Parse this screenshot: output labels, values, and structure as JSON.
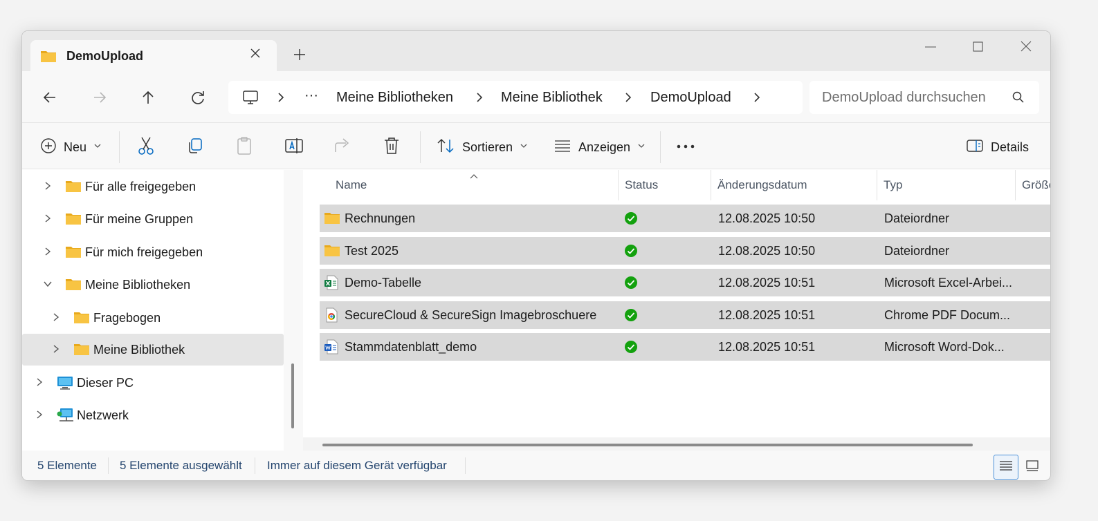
{
  "tab": {
    "title": "DemoUpload"
  },
  "breadcrumb": {
    "items": [
      "Meine Bibliotheken",
      "Meine Bibliothek",
      "DemoUpload"
    ],
    "overflow": "···"
  },
  "search": {
    "placeholder": "DemoUpload durchsuchen"
  },
  "toolbar": {
    "new_label": "Neu",
    "sort_label": "Sortieren",
    "view_label": "Anzeigen",
    "more_label": "•••",
    "details_label": "Details"
  },
  "sidebar": {
    "items": [
      {
        "label": "Für alle freigegeben",
        "icon": "folder-icon"
      },
      {
        "label": "Für meine Gruppen",
        "icon": "folder-icon"
      },
      {
        "label": "Für mich freigegeben",
        "icon": "folder-icon"
      },
      {
        "label": "Meine Bibliotheken",
        "icon": "folder-icon",
        "expanded": true
      },
      {
        "label": "Fragebogen",
        "icon": "folder-icon"
      },
      {
        "label": "Meine Bibliothek",
        "icon": "folder-icon",
        "selected": true
      },
      {
        "label": "Dieser PC",
        "icon": "pc-icon"
      },
      {
        "label": "Netzwerk",
        "icon": "network-icon"
      }
    ]
  },
  "columns": {
    "name": "Name",
    "status": "Status",
    "date": "Änderungsdatum",
    "type": "Typ",
    "size": "Größe"
  },
  "files": [
    {
      "name": "Rechnungen",
      "date": "12.08.2025 10:50",
      "type": "Dateiordner",
      "icon": "folder-icon"
    },
    {
      "name": "Test 2025",
      "date": "12.08.2025 10:50",
      "type": "Dateiordner",
      "icon": "folder-icon"
    },
    {
      "name": "Demo-Tabelle",
      "date": "12.08.2025 10:51",
      "type": "Microsoft Excel-Arbei...",
      "icon": "excel-file-icon"
    },
    {
      "name": "SecureCloud & SecureSign Imagebroschuere",
      "date": "12.08.2025 10:51",
      "type": "Chrome PDF Docum...",
      "icon": "chrome-pdf-icon"
    },
    {
      "name": "Stammdatenblatt_demo",
      "date": "12.08.2025 10:51",
      "type": "Microsoft Word-Dok...",
      "icon": "word-file-icon"
    }
  ],
  "statusbar": {
    "count": "5 Elemente",
    "selected": "5 Elemente ausgewählt",
    "availability": "Immer auf diesem Gerät verfügbar"
  },
  "colors": {
    "accent": "#0067c0",
    "folder": "#f8c443",
    "status_ok": "#13a10e",
    "selection": "#d9d9d9"
  }
}
